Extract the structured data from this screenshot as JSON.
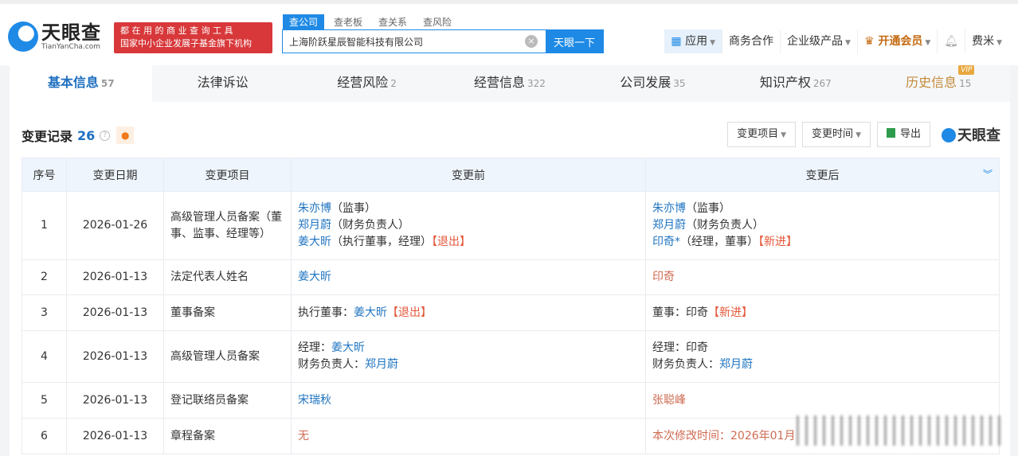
{
  "header": {
    "logo_text": "天眼查",
    "logo_domain": "TianYanCha.com",
    "ad_line1": "都 在 用 的 商 业 查 询 工 具",
    "ad_line2": "国家中小企业发展子基金旗下机构",
    "search_tabs": [
      "查公司",
      "查老板",
      "查关系",
      "查风险"
    ],
    "search_value": "上海阶跃星辰智能科技有限公司",
    "search_button": "天眼一下",
    "nav": {
      "apps": "应用",
      "business": "商务合作",
      "enterprise": "企业级产品",
      "vip": "开通会员",
      "user": "费米"
    }
  },
  "tabs": [
    {
      "label": "基本信息",
      "count": "57"
    },
    {
      "label": "法律诉讼",
      "count": ""
    },
    {
      "label": "经营风险",
      "count": "2"
    },
    {
      "label": "经营信息",
      "count": "322"
    },
    {
      "label": "公司发展",
      "count": "35"
    },
    {
      "label": "知识产权",
      "count": "267"
    },
    {
      "label": "历史信息",
      "count": "15",
      "badge": "VIP"
    }
  ],
  "section": {
    "title": "变更记录",
    "count": "26",
    "filter_item": "变更项目",
    "filter_time": "变更时间",
    "export": "导出",
    "brand": "天眼查"
  },
  "table": {
    "headers": [
      "序号",
      "变更日期",
      "变更项目",
      "变更前",
      "变更后"
    ],
    "rows": [
      {
        "no": "1",
        "date": "2026-01-26",
        "item": "高级管理人员备案（董事、监事、经理等）",
        "before": [
          [
            {
              "t": "朱亦博",
              "s": "link"
            },
            {
              "t": "（监事）",
              "s": "plain"
            }
          ],
          [
            {
              "t": "郑月蔚",
              "s": "link"
            },
            {
              "t": "（财务负责人）",
              "s": "plain"
            }
          ],
          [
            {
              "t": "姜大昕",
              "s": "link"
            },
            {
              "t": "（执行董事，经理）",
              "s": "plain"
            },
            {
              "t": "【退出】",
              "s": "red"
            }
          ]
        ],
        "after": [
          [
            {
              "t": "朱亦博",
              "s": "link"
            },
            {
              "t": "（监事）",
              "s": "plain"
            }
          ],
          [
            {
              "t": "郑月蔚",
              "s": "link"
            },
            {
              "t": "（财务负责人）",
              "s": "plain"
            }
          ],
          [
            {
              "t": "印奇*",
              "s": "link"
            },
            {
              "t": "（经理，董事）",
              "s": "plain"
            },
            {
              "t": "【新进】",
              "s": "red"
            }
          ]
        ]
      },
      {
        "no": "2",
        "date": "2026-01-13",
        "item": "法定代表人姓名",
        "before": [
          [
            {
              "t": "姜大昕",
              "s": "link"
            }
          ]
        ],
        "after": [
          [
            {
              "t": "印奇",
              "s": "org"
            }
          ]
        ]
      },
      {
        "no": "3",
        "date": "2026-01-13",
        "item": "董事备案",
        "before": [
          [
            {
              "t": "执行董事：",
              "s": "plain"
            },
            {
              "t": "姜大昕",
              "s": "link"
            },
            {
              "t": "【退出】",
              "s": "red"
            }
          ]
        ],
        "after": [
          [
            {
              "t": "董事：印奇",
              "s": "plain"
            },
            {
              "t": "【新进】",
              "s": "red"
            }
          ]
        ]
      },
      {
        "no": "4",
        "date": "2026-01-13",
        "item": "高级管理人员备案",
        "before": [
          [
            {
              "t": "经理：",
              "s": "plain"
            },
            {
              "t": "姜大昕",
              "s": "link"
            }
          ],
          [
            {
              "t": "财务负责人：",
              "s": "plain"
            },
            {
              "t": "郑月蔚",
              "s": "link"
            }
          ]
        ],
        "after": [
          [
            {
              "t": "经理：印奇",
              "s": "plain"
            }
          ],
          [
            {
              "t": "财务负责人：",
              "s": "plain"
            },
            {
              "t": "郑月蔚",
              "s": "link"
            }
          ]
        ]
      },
      {
        "no": "5",
        "date": "2026-01-13",
        "item": "登记联络员备案",
        "before": [
          [
            {
              "t": "宋瑞秋",
              "s": "link"
            }
          ]
        ],
        "after": [
          [
            {
              "t": "张聪峰",
              "s": "org"
            }
          ]
        ]
      },
      {
        "no": "6",
        "date": "2026-01-13",
        "item": "章程备案",
        "before": [
          [
            {
              "t": "无",
              "s": "org"
            }
          ]
        ],
        "after": [
          [
            {
              "t": "本次修改时间：2026年01月",
              "s": "org"
            }
          ]
        ]
      }
    ]
  },
  "colors": {
    "accent": "#1e8ae6",
    "link": "#1f74c0",
    "tag_red": "#e4573a",
    "value_orange": "#cf6b52"
  }
}
